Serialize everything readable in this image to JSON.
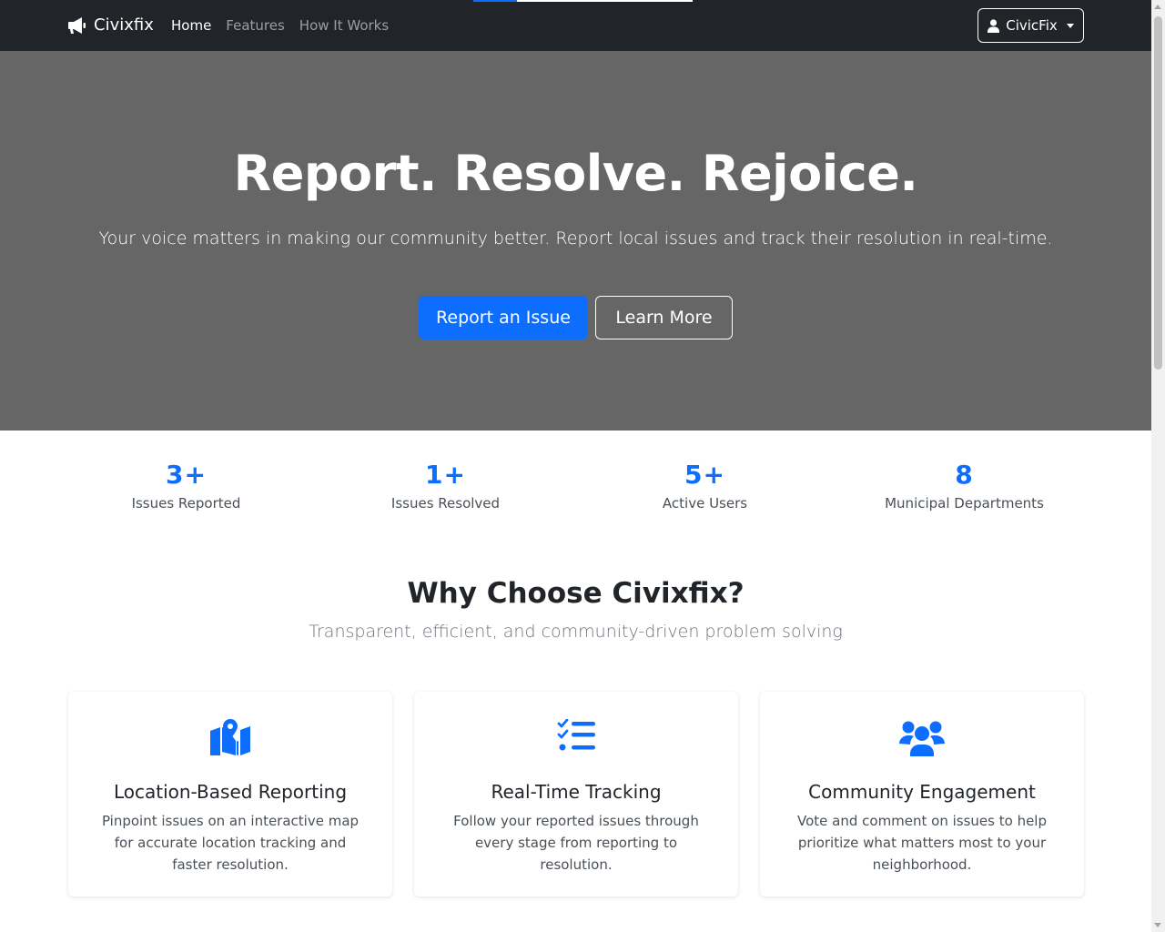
{
  "navbar": {
    "brand": "Civixfix",
    "links": [
      {
        "label": "Home",
        "active": true
      },
      {
        "label": "Features",
        "active": false
      },
      {
        "label": "How It Works",
        "active": false
      }
    ],
    "user_label": "CivicFix"
  },
  "hero": {
    "title": "Report. Resolve. Rejoice.",
    "subtitle": "Your voice matters in making our community better. Report local issues and track their resolution in real-time.",
    "primary_button": "Report an Issue",
    "secondary_button": "Learn More"
  },
  "stats": [
    {
      "value": "3+",
      "label": "Issues Reported"
    },
    {
      "value": "1+",
      "label": "Issues Resolved"
    },
    {
      "value": "5+",
      "label": "Active Users"
    },
    {
      "value": "8",
      "label": "Municipal Departments"
    }
  ],
  "why": {
    "title": "Why Choose Civixfix?",
    "subtitle": "Transparent, efficient, and community-driven problem solving"
  },
  "features": [
    {
      "icon": "map-location-icon",
      "title": "Location-Based Reporting",
      "text": "Pinpoint issues on an interactive map for accurate location tracking and faster resolution."
    },
    {
      "icon": "list-check-icon",
      "title": "Real-Time Tracking",
      "text": "Follow your reported issues through every stage from reporting to resolution."
    },
    {
      "icon": "users-icon",
      "title": "Community Engagement",
      "text": "Vote and comment on issues to help prioritize what matters most to your neighborhood."
    }
  ],
  "colors": {
    "primary": "#0d6efd",
    "navbar_bg": "#212529",
    "hero_bg": "#666666"
  }
}
